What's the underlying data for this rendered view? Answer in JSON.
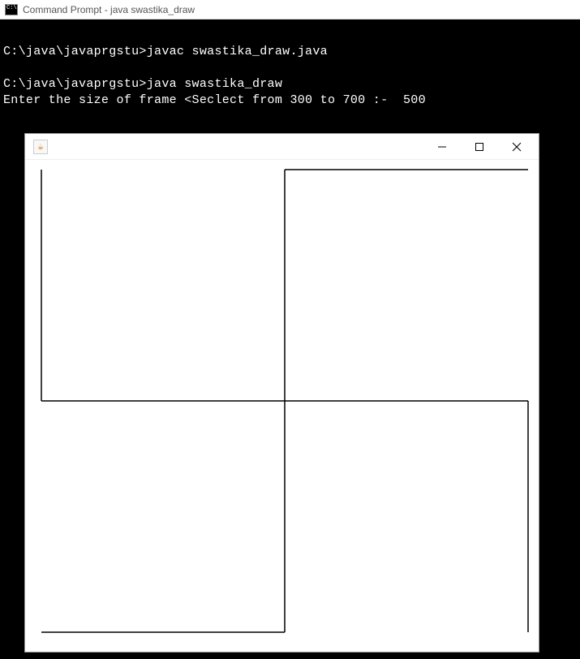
{
  "outerWindow": {
    "title": "Command Prompt - java  swastika_draw"
  },
  "console": {
    "line1": "C:\\java\\javaprgstu>javac swastika_draw.java",
    "line2": "C:\\java\\javaprgstu>java swastika_draw",
    "line3": "Enter the size of frame <Seclect from 300 to 700 :-  500"
  },
  "javaWindow": {
    "iconSymbol": "☕",
    "minimizeLabel": "Minimize",
    "maximizeLabel": "Maximize",
    "closeLabel": "Close"
  },
  "drawing": {
    "frameSize": 500,
    "colorHex": "#000000"
  }
}
